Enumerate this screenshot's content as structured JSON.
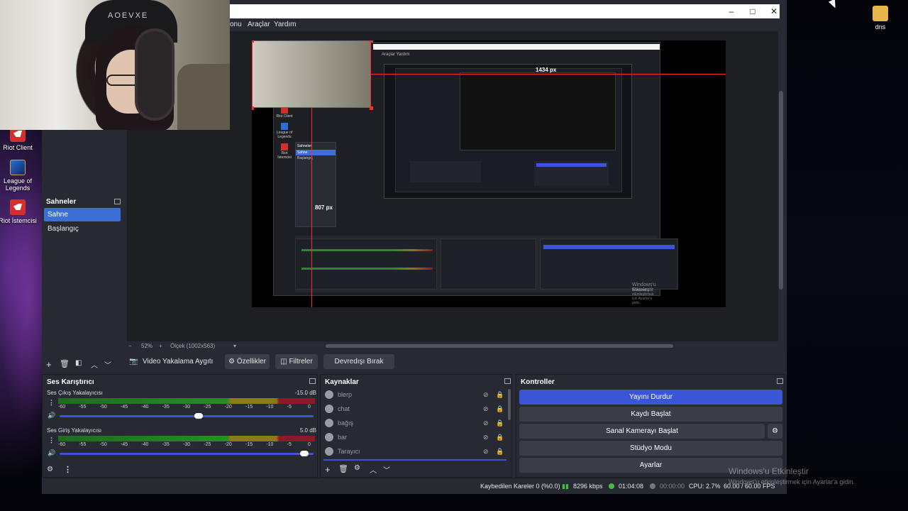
{
  "desktop": {
    "icons": [
      {
        "label": "Riot Client",
        "icon": "riot-client-icon"
      },
      {
        "label": "League of Legends",
        "icon": "league-of-legends-icon"
      },
      {
        "label": "Riot İstemcisi",
        "icon": "riot-client-icon"
      },
      {
        "label": "dns",
        "icon": "folder-icon"
      }
    ],
    "watermark_title": "Windows'u Etkinleştir",
    "watermark_sub": "Windows'u etkinleştirmek için Ayarlar'a gidin."
  },
  "webcam": {
    "chair_brand": "AOEVXE"
  },
  "window": {
    "menu": [
      "onu",
      "Araçlar",
      "Yardım"
    ],
    "controls": {
      "minimize": "–",
      "maximize": "□",
      "close": "✕"
    }
  },
  "preview": {
    "measure_width": "1434 px",
    "measure_height": "807 px",
    "nested_menu": "Araçlar   Yardım",
    "nested_scenes": {
      "title": "Sahneler",
      "selected": "Sahne",
      "other": "Başlangıç"
    },
    "nested_icons": [
      "Riot Client",
      "League of Legends",
      "Riot İstemcisi"
    ],
    "nested_watermark": "Windows'u Etkinleştir",
    "nested_watermark_sub": "Windows'u etkinleştirmek için Ayarlar'a gidin.",
    "zoom": "52%",
    "scale": "Ölçek (1002x563)"
  },
  "scenes": {
    "title": "Sahneler",
    "items": [
      "Sahne",
      "Başlangıç"
    ],
    "selected_index": 0
  },
  "source_toolbar": {
    "source_name": "Video Yakalama Aygıtı",
    "properties": "Özellikler",
    "filters": "Filtreler",
    "deactivate": "Devredışı Bırak"
  },
  "mixer": {
    "title": "Ses Karıştırıcı",
    "channels": [
      {
        "name": "Ses Çıkış Yakalayıcısı",
        "db": "-15.0 dB",
        "volume": 0.55
      },
      {
        "name": "Ses Giriş Yakalayıcısı",
        "db": "5.0 dB",
        "volume": 0.98
      }
    ],
    "scale": [
      "-60",
      "-55",
      "-50",
      "-45",
      "-40",
      "-35",
      "-30",
      "-25",
      "-20",
      "-15",
      "-10",
      "-5",
      "0"
    ]
  },
  "sources": {
    "title": "Kaynaklar",
    "items": [
      "blerp",
      "chat",
      "bağış",
      "bar",
      "Tarayıcı"
    ]
  },
  "controls": {
    "title": "Kontroller",
    "buttons": [
      "Yayını Durdur",
      "Kaydı Başlat",
      "Sanal Kamerayı Başlat",
      "Stüdyo Modu",
      "Ayarlar"
    ]
  },
  "status": {
    "dropped": "Kaybedilen Kareler 0 (%0.0)",
    "bitrate": "8296 kbps",
    "stream_time": "01:04:08",
    "rec_time": "00:00:00",
    "cpu": "CPU: 2.7%",
    "fps": "60.00 / 60.00 FPS"
  },
  "colors": {
    "accent": "#3b55d9",
    "selection": "#3b6fd6",
    "panel": "#272a33",
    "measure": "#ff2a2a"
  }
}
